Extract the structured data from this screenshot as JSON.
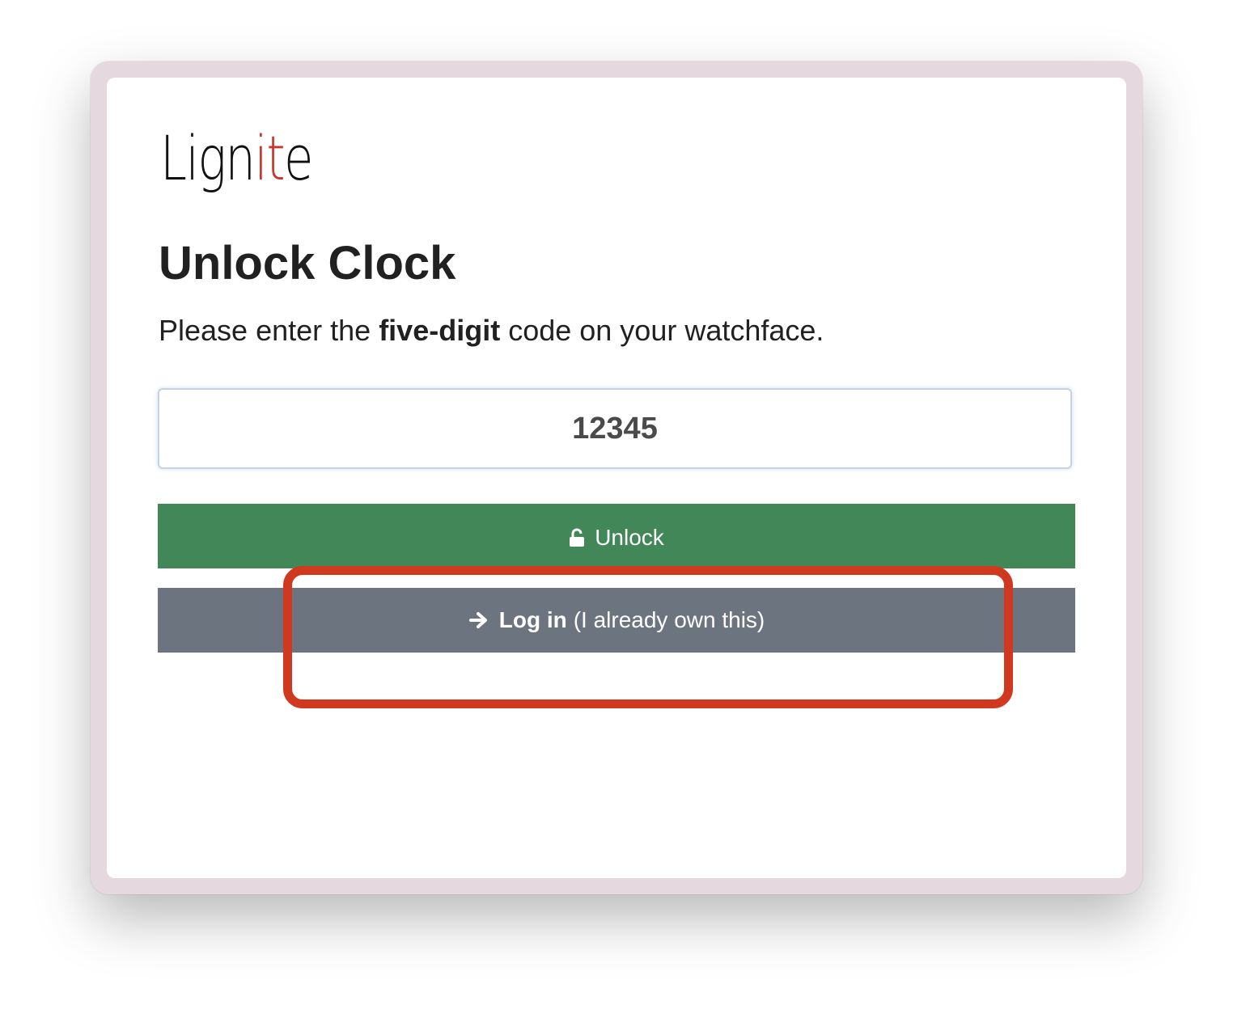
{
  "logo": {
    "part_a": "Lign",
    "part_b": "it",
    "part_c": "e"
  },
  "page": {
    "title": "Unlock Clock",
    "instruction_before": "Please enter the ",
    "instruction_bold": "five-digit",
    "instruction_after": " code on your watchface."
  },
  "code_input": {
    "value": "12345"
  },
  "buttons": {
    "unlock": {
      "label": "Unlock",
      "icon": "unlock-icon"
    },
    "login": {
      "label_bold": "Log in",
      "label_rest": "(I already own this)",
      "icon": "arrow-right-icon"
    }
  },
  "colors": {
    "unlock_bg": "#418757",
    "login_bg": "#6c757f",
    "highlight": "#d0391f",
    "logo_accent": "#c8372c"
  }
}
